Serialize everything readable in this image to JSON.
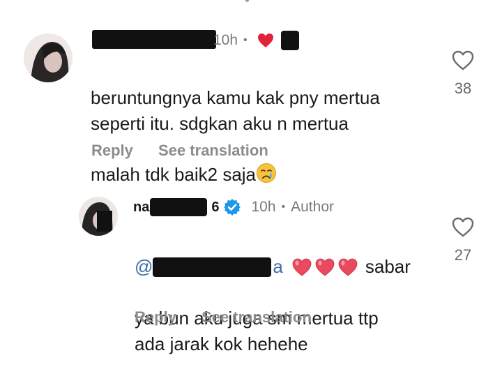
{
  "comments": [
    {
      "time": "10h",
      "separator": "•",
      "text": "beruntungnya kamu kak pny mertua\nseperti itu. sdgkan aku n mertua\nmalah tdk baik2 saja",
      "emoji_icon": "crying-face-icon",
      "reply_label": "Reply",
      "translate_label": "See translation",
      "likes": "38",
      "liked_by_author": true
    },
    {
      "username_prefix": "na",
      "username_suffix": "6",
      "verified": true,
      "time": "10h",
      "separator": "•",
      "author_badge": "Author",
      "mention_prefix": "@",
      "mention_suffix": "a",
      "hearts_icon": "heart-emoji-icon",
      "text_line1": "sabar",
      "text_rest": "ya bun aku juga sm mertua ttp\nada jarak kok hehehe",
      "reply_label": "Reply",
      "translate_label": "See translation",
      "likes": "27"
    }
  ],
  "colors": {
    "heart_red": "#e0223b",
    "verified_blue": "#1e96ea",
    "mention_blue": "#3b6ea5",
    "meta_gray": "#7a7a7a",
    "action_gray": "#8c8c8c",
    "emoji_heart": "#ea4a5f"
  }
}
